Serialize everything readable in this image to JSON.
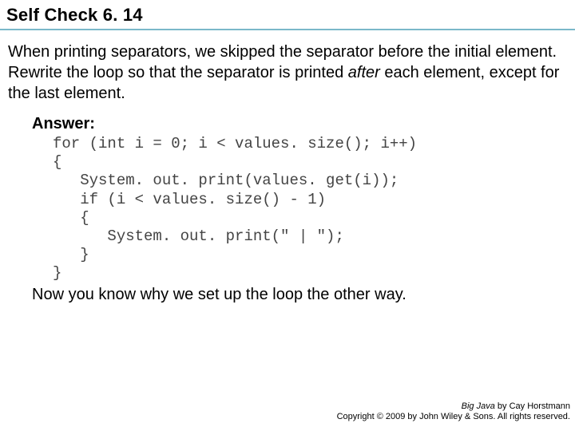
{
  "title": "Self Check 6. 14",
  "question": {
    "part1": "When printing separators, we skipped the separator before the initial element. Rewrite the loop so that the separator is printed ",
    "emph": "after",
    "part2": " each element, except for the last element."
  },
  "answer_label": "Answer:",
  "code": "for (int i = 0; i < values. size(); i++)\n{\n   System. out. print(values. get(i));\n   if (i < values. size() - 1)\n   {\n      System. out. print(\" | \");\n   }\n}",
  "conclusion": "Now you know why we set up the loop the other way.",
  "footer": {
    "book": "Big Java",
    "by": " by Cay Horstmann",
    "copyright": "Copyright © 2009 by John Wiley & Sons.  All rights reserved."
  }
}
